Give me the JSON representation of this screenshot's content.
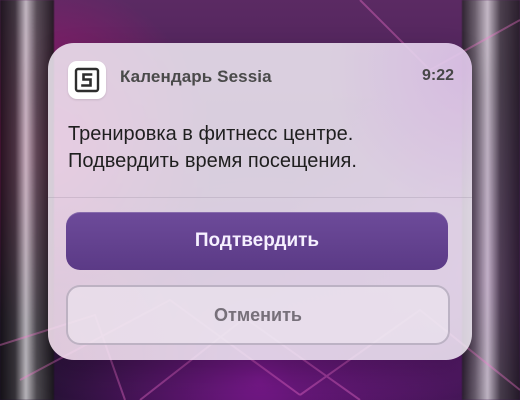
{
  "notification": {
    "app_name": "Календарь Sessia",
    "time": "9:22",
    "message_line_1": "Тренировка в фитнесс центре.",
    "message_line_2": "Подвердить время посещения.",
    "app_icon": "calendar-s-icon"
  },
  "actions": {
    "confirm_label": "Подтвердить",
    "cancel_label": "Отменить"
  },
  "colors": {
    "primary": "#5b3a86",
    "card_background": "#f1ebf4",
    "text": "#1f1f1f",
    "background": "#3b1a4d"
  }
}
